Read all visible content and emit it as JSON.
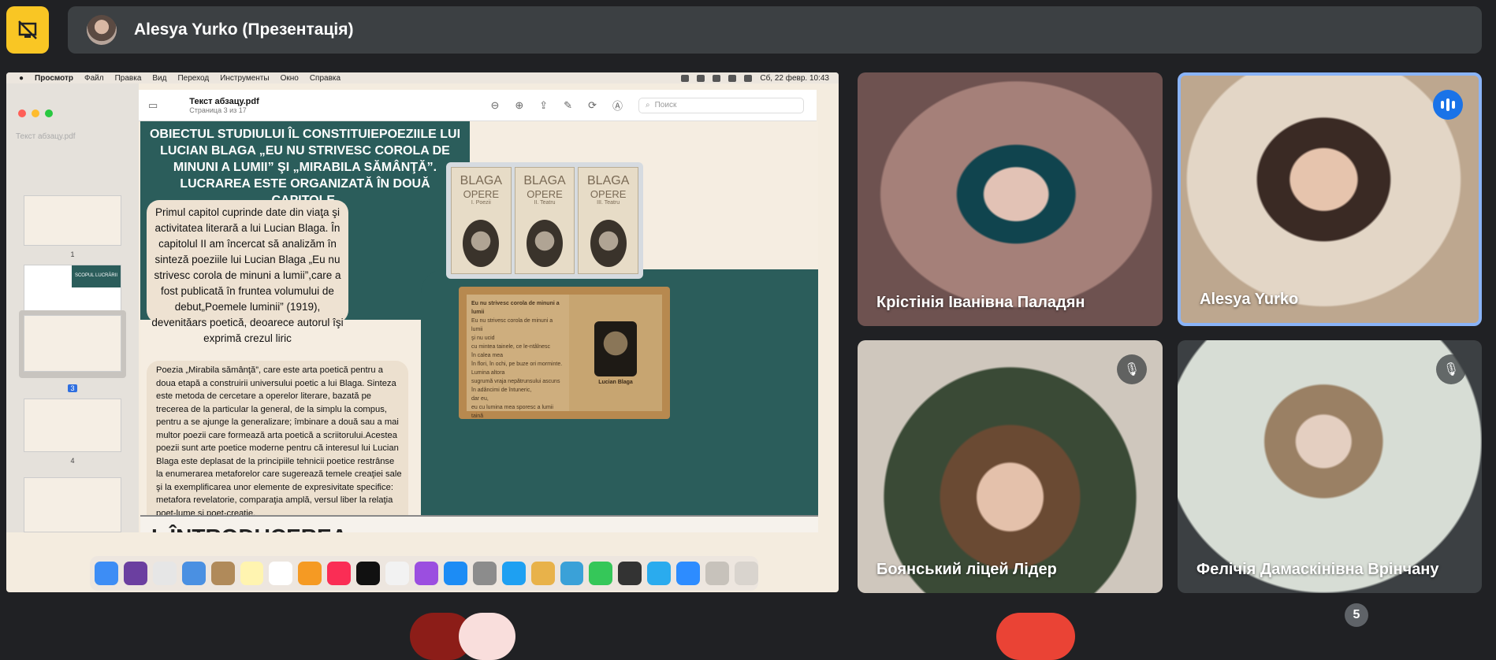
{
  "presenter": {
    "name": "Alesya Yurko (Презентація)",
    "stop_icon": "stop-presenting-icon"
  },
  "mac_menu": {
    "app": "Просмотр",
    "items": [
      "Файл",
      "Правка",
      "Вид",
      "Переход",
      "Инструменты",
      "Окно",
      "Справка"
    ],
    "clock": "Сб, 22 февр.  10:43"
  },
  "pdf": {
    "title": "Текст абзацу.pdf",
    "page_info": "Страница 3 из 17",
    "search_placeholder": "Поиск",
    "sidebar_title": "Текст абзацу.pdf",
    "thumb_labels": [
      "1",
      "2",
      "3",
      "4"
    ],
    "thumb2_title": "SCOPUL LUCRĂRII"
  },
  "slide": {
    "heading": "OBIECTUL STUDIULUI ÎL CONSTITUIEPOEZIILE LUI LUCIAN BLAGA „EU NU STRIVESC COROLA DE MINUNI A LUMII” ŞI „MIRABILA SĂMÂNŢĂ”. LUCRAREA ESTE ORGANIZATĂ ÎN DOUĂ CAPITOLE.",
    "box1": "Primul capitol cuprinde date din viaţa şi activitatea literară a lui Lucian Blaga. În capitolul II am încercat să analizăm în sinteză poeziile lui Lucian Blaga „Eu nu strivesc corola de minuni a lumii”,care a fost publicată în fruntea volumului de debut„Poemele luminii” (1919), devenităars poetică, deoarece autorul îşi exprimă crezul liric",
    "box2": "Poezia „Mirabila sămânţă”, care este arta poetică pentru a doua etapă a construirii universului poetic a lui Blaga. Sinteza este metoda de cercetare a operelor literare, bazată pe trecerea de la particular la general, de la simplu la compus, pentru a se ajunge la generalizare; îmbinare a două sau a mai multor poezii care formează arta poetică a scriitorului.Acestea poezii sunt arte poetice moderne pentru că interesul lui Lucian Blaga este deplasat de la principiile tehnicii poetice restrânse la enumerarea metaforelor care sugerează temele creaţiei sale şi la exemplificarea unor elemente de expresivitate specifice: metafora revelatorie, comparaţia amplă, versul liber la relaţia poet-lume şi poet-creaţie.",
    "book_title": "BLAGA",
    "book_sub": "OPERE",
    "book_vols": [
      "I. Poezii",
      "II. Teatru",
      "III. Teatru"
    ],
    "open_book_title": "Eu nu strivesc corola de minuni a lumii",
    "open_book_lines": [
      "Eu nu strivesc corola de minuni a lumii",
      "şi nu ucid",
      "cu mintea tainele, ce le-ntâlnesc",
      "în calea mea",
      "în flori, în ochi, pe buze ori morminte.",
      "Lumina altora",
      "sugrumă vraja nepătrunsului ascuns",
      "în adâncimi de întuneric,",
      "dar eu,",
      "eu cu lumina mea sporesc a lumii taină"
    ],
    "portrait_caption": "Lucian Blaga",
    "next_heading": "I. ÎNTRODUCEREA"
  },
  "tiles": [
    {
      "name": "Крістінія Іванівна Паладян",
      "state": "video"
    },
    {
      "name": "Alesya Yurko",
      "state": "speaking"
    },
    {
      "name": "Боянський ліцей Лідер",
      "state": "muted"
    },
    {
      "name": "Фелічія Дамаскінівна Врінчану",
      "state": "muted"
    }
  ],
  "people_count": "5",
  "colors": {
    "accent": "#f9c624",
    "slide_teal": "#2b5d5b",
    "speaking_blue": "#1a73e8",
    "end_call": "#ea4335"
  }
}
